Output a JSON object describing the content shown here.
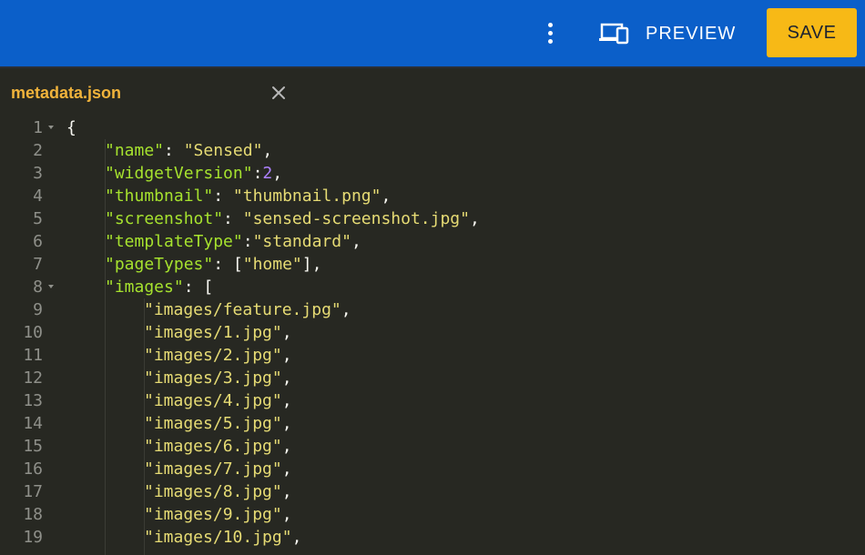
{
  "topbar": {
    "more_icon": "more-vertical-icon",
    "preview_icon": "devices-icon",
    "preview_label": "PREVIEW",
    "save_label": "SAVE",
    "bar_color": "#0b5fc9",
    "save_color": "#f7b916"
  },
  "tab": {
    "title": "metadata.json",
    "close_icon": "close-icon"
  },
  "editor": {
    "lines": [
      {
        "n": "1",
        "fold": true,
        "indent": 0,
        "tokens": [
          {
            "t": "{",
            "c": "p"
          }
        ]
      },
      {
        "n": "2",
        "fold": false,
        "indent": 1,
        "tokens": [
          {
            "t": "\"name\"",
            "c": "k"
          },
          {
            "t": ": ",
            "c": "p"
          },
          {
            "t": "\"Sensed\"",
            "c": "s"
          },
          {
            "t": ",",
            "c": "p"
          }
        ]
      },
      {
        "n": "3",
        "fold": false,
        "indent": 1,
        "tokens": [
          {
            "t": "\"widgetVersion\"",
            "c": "k"
          },
          {
            "t": ":",
            "c": "p"
          },
          {
            "t": "2",
            "c": "n"
          },
          {
            "t": ",",
            "c": "p"
          }
        ]
      },
      {
        "n": "4",
        "fold": false,
        "indent": 1,
        "tokens": [
          {
            "t": "\"thumbnail\"",
            "c": "k"
          },
          {
            "t": ": ",
            "c": "p"
          },
          {
            "t": "\"thumbnail.png\"",
            "c": "s"
          },
          {
            "t": ",",
            "c": "p"
          }
        ]
      },
      {
        "n": "5",
        "fold": false,
        "indent": 1,
        "tokens": [
          {
            "t": "\"screenshot\"",
            "c": "k"
          },
          {
            "t": ": ",
            "c": "p"
          },
          {
            "t": "\"sensed-screenshot.jpg\"",
            "c": "s"
          },
          {
            "t": ",",
            "c": "p"
          }
        ]
      },
      {
        "n": "6",
        "fold": false,
        "indent": 1,
        "tokens": [
          {
            "t": "\"templateType\"",
            "c": "k"
          },
          {
            "t": ":",
            "c": "p"
          },
          {
            "t": "\"standard\"",
            "c": "s"
          },
          {
            "t": ",",
            "c": "p"
          }
        ]
      },
      {
        "n": "7",
        "fold": false,
        "indent": 1,
        "tokens": [
          {
            "t": "\"pageTypes\"",
            "c": "k"
          },
          {
            "t": ": [",
            "c": "p"
          },
          {
            "t": "\"home\"",
            "c": "s"
          },
          {
            "t": "],",
            "c": "p"
          }
        ]
      },
      {
        "n": "8",
        "fold": true,
        "indent": 1,
        "tokens": [
          {
            "t": "\"images\"",
            "c": "k"
          },
          {
            "t": ": [",
            "c": "p"
          }
        ]
      },
      {
        "n": "9",
        "fold": false,
        "indent": 2,
        "tokens": [
          {
            "t": "\"images/feature.jpg\"",
            "c": "s"
          },
          {
            "t": ",",
            "c": "p"
          }
        ]
      },
      {
        "n": "10",
        "fold": false,
        "indent": 2,
        "tokens": [
          {
            "t": "\"images/1.jpg\"",
            "c": "s"
          },
          {
            "t": ",",
            "c": "p"
          }
        ]
      },
      {
        "n": "11",
        "fold": false,
        "indent": 2,
        "tokens": [
          {
            "t": "\"images/2.jpg\"",
            "c": "s"
          },
          {
            "t": ",",
            "c": "p"
          }
        ]
      },
      {
        "n": "12",
        "fold": false,
        "indent": 2,
        "tokens": [
          {
            "t": "\"images/3.jpg\"",
            "c": "s"
          },
          {
            "t": ",",
            "c": "p"
          }
        ]
      },
      {
        "n": "13",
        "fold": false,
        "indent": 2,
        "tokens": [
          {
            "t": "\"images/4.jpg\"",
            "c": "s"
          },
          {
            "t": ",",
            "c": "p"
          }
        ]
      },
      {
        "n": "14",
        "fold": false,
        "indent": 2,
        "tokens": [
          {
            "t": "\"images/5.jpg\"",
            "c": "s"
          },
          {
            "t": ",",
            "c": "p"
          }
        ]
      },
      {
        "n": "15",
        "fold": false,
        "indent": 2,
        "tokens": [
          {
            "t": "\"images/6.jpg\"",
            "c": "s"
          },
          {
            "t": ",",
            "c": "p"
          }
        ]
      },
      {
        "n": "16",
        "fold": false,
        "indent": 2,
        "tokens": [
          {
            "t": "\"images/7.jpg\"",
            "c": "s"
          },
          {
            "t": ",",
            "c": "p"
          }
        ]
      },
      {
        "n": "17",
        "fold": false,
        "indent": 2,
        "tokens": [
          {
            "t": "\"images/8.jpg\"",
            "c": "s"
          },
          {
            "t": ",",
            "c": "p"
          }
        ]
      },
      {
        "n": "18",
        "fold": false,
        "indent": 2,
        "tokens": [
          {
            "t": "\"images/9.jpg\"",
            "c": "s"
          },
          {
            "t": ",",
            "c": "p"
          }
        ]
      },
      {
        "n": "19",
        "fold": false,
        "indent": 2,
        "tokens": [
          {
            "t": "\"images/10.jpg\"",
            "c": "s"
          },
          {
            "t": ",",
            "c": "p"
          }
        ]
      }
    ]
  }
}
